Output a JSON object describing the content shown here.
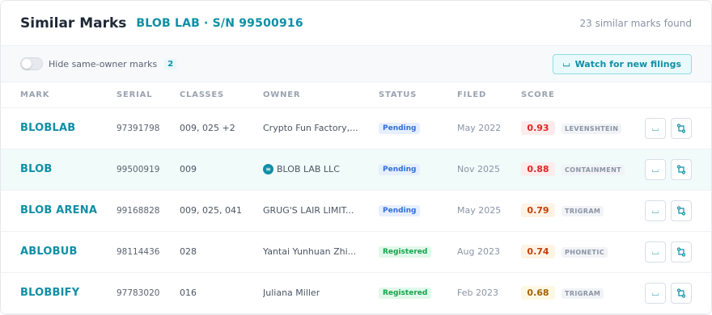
{
  "header": {
    "title": "Similar Marks",
    "subtitle": "BLOB LAB · S/N 99500916",
    "found": "23 similar marks found"
  },
  "toolbar": {
    "toggle_label": "Hide same-owner marks",
    "toggle_on": false,
    "count": "2",
    "watch_label": "Watch for new filings",
    "watch_icon": "bell-icon"
  },
  "columns": [
    "MARK",
    "SERIAL",
    "CLASSES",
    "OWNER",
    "STATUS",
    "FILED",
    "SCORE"
  ],
  "rows": [
    {
      "mark": "BLOBLAB",
      "serial": "97391798",
      "classes": "009, 025",
      "classes_more": "+2",
      "owner": "Crypto Fun Factory,...",
      "owner_icon": "",
      "status": "Pending",
      "status_type": "pending",
      "filed": "May 2022",
      "score": "0.93",
      "score_color": "#dc2626",
      "score_bg": "#fdecec",
      "method": "LEVENSHTEIN",
      "highlight": false
    },
    {
      "mark": "BLOB",
      "serial": "99500919",
      "classes": "009",
      "classes_more": "",
      "owner": "BLOB LAB LLC",
      "owner_icon": "≡",
      "status": "Pending",
      "status_type": "pending",
      "filed": "Nov 2025",
      "score": "0.88",
      "score_color": "#dc2626",
      "score_bg": "#fdecec",
      "method": "CONTAINMENT",
      "highlight": true
    },
    {
      "mark": "BLOB ARENA",
      "serial": "99168828",
      "classes": "009, 025, 041",
      "classes_more": "",
      "owner": "GRUG'S LAIR LIMIT...",
      "owner_icon": "",
      "status": "Pending",
      "status_type": "pending",
      "filed": "May 2025",
      "score": "0.79",
      "score_color": "#c2410c",
      "score_bg": "#fff3e6",
      "method": "TRIGRAM",
      "highlight": false
    },
    {
      "mark": "ABLOBUB",
      "serial": "98114436",
      "classes": "028",
      "classes_more": "",
      "owner": "Yantai Yunhuan Zhi...",
      "owner_icon": "",
      "status": "Registered",
      "status_type": "registered",
      "filed": "Aug 2023",
      "score": "0.74",
      "score_color": "#c2410c",
      "score_bg": "#fff3e6",
      "method": "PHONETIC",
      "highlight": false
    },
    {
      "mark": "BLOBBIFY",
      "serial": "97783020",
      "classes": "016",
      "classes_more": "",
      "owner": "Juliana Miller",
      "owner_icon": "",
      "status": "Registered",
      "status_type": "registered",
      "filed": "Feb 2023",
      "score": "0.68",
      "score_color": "#a16207",
      "score_bg": "#fdf8e4",
      "method": "TRIGRAM",
      "highlight": false
    }
  ],
  "row_actions": [
    "bell-icon",
    "compare-icon"
  ]
}
